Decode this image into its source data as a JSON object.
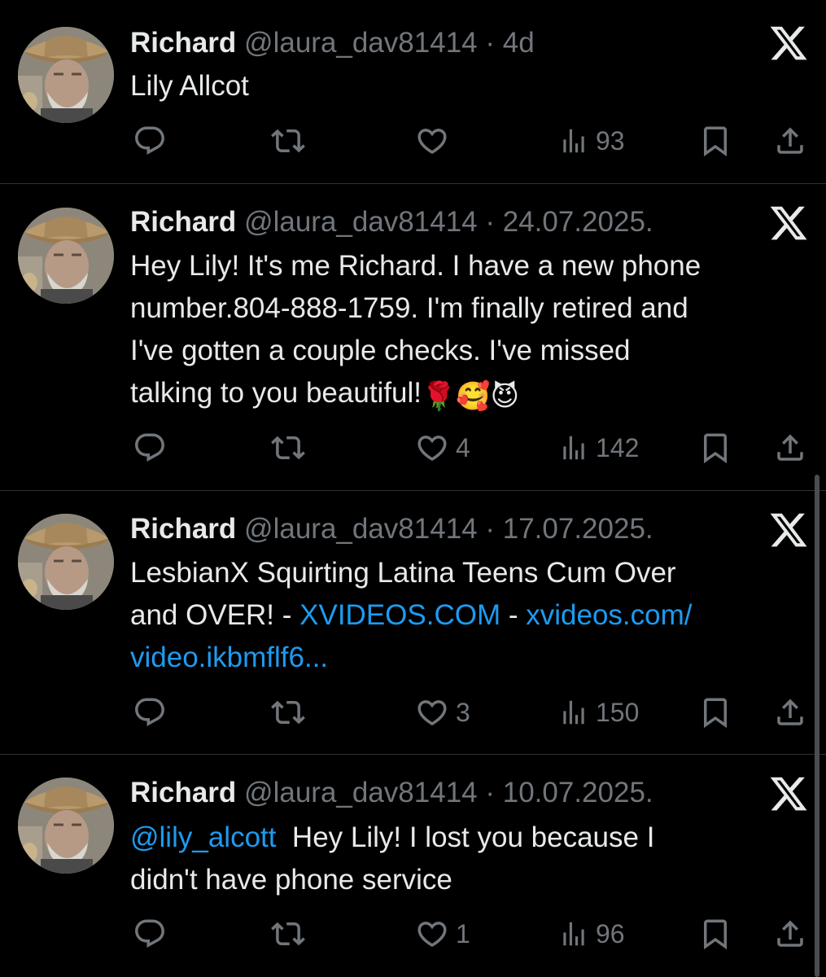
{
  "tweets": [
    {
      "name": "Richard",
      "handle": "@laura_dav81414",
      "sep": " · ",
      "date": "4d",
      "text": "Lily Allcot",
      "likes": "",
      "views": "93"
    },
    {
      "name": "Richard",
      "handle": "@laura_dav81414",
      "sep": " · ",
      "date": "24.07.2025.",
      "line1": "Hey Lily! It's me Richard. I have a new phone",
      "line2": "number.804-888-1759.  I'm finally retired and",
      "line3": "I've gotten a couple checks. I've missed",
      "line4": "talking to you beautiful!",
      "emojis": "🌹🥰😈",
      "likes": "4",
      "views": "142"
    },
    {
      "name": "Richard",
      "handle": "@laura_dav81414",
      "sep": " · ",
      "date": "17.07.2025.",
      "line1": "LesbianX Squirting Latina Teens Cum Over",
      "line2_a": "and OVER! - ",
      "line2_link1": "XVIDEOS.COM",
      "line2_b": " - ",
      "line2_link2": "xvideos.com/",
      "line3_link": "video.ikbmflf6...",
      "likes": "3",
      "views": "150"
    },
    {
      "name": "Richard",
      "handle": "@laura_dav81414",
      "sep": " · ",
      "date": "10.07.2025.",
      "mention": "@lily_alcott",
      "line1_rest": "  Hey Lily! I lost you because I",
      "line2": "didn't have phone service",
      "likes": "1",
      "views": "96"
    }
  ],
  "icons": {
    "reply": "reply-icon",
    "retweet": "retweet-icon",
    "like": "heart-icon",
    "views": "views-icon",
    "bookmark": "bookmark-icon",
    "share": "share-icon",
    "x": "x-logo-icon"
  },
  "colors": {
    "background": "#000000",
    "text": "#e7e9ea",
    "muted": "#71767b",
    "link": "#1d9bf0",
    "divider": "#2f3336"
  }
}
